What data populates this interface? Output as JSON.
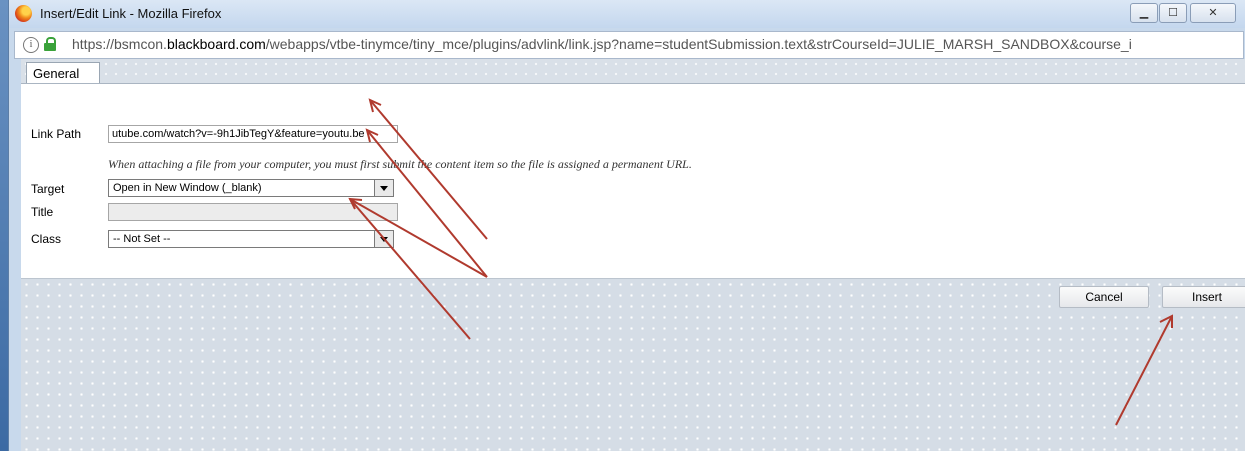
{
  "window": {
    "title": "Insert/Edit Link - Mozilla Firefox",
    "url_prefix": "https://bsmcon.",
    "url_domain": "blackboard.com",
    "url_suffix": "/webapps/vtbe-tinymce/tiny_mce/plugins/advlink/link.jsp?name=studentSubmission.text&strCourseId=JULIE_MARSH_SANDBOX&course_i",
    "icons": {
      "browser": "firefox-icon",
      "info": "info-icon",
      "secure": "lock-icon"
    }
  },
  "dialog": {
    "tab_label": "General",
    "fields": {
      "link_path": {
        "label": "Link Path",
        "value": "utube.com/watch?v=-9h1JibTegY&feature=youtu.be"
      },
      "hint": "When attaching a file from your computer, you must first submit the content item so the file is assigned a permanent URL.",
      "target": {
        "label": "Target",
        "value": "Open in New Window (_blank)"
      },
      "title": {
        "label": "Title",
        "value": ""
      },
      "class": {
        "label": "Class",
        "value": "-- Not Set --"
      }
    },
    "buttons": {
      "cancel": "Cancel",
      "insert": "Insert"
    }
  },
  "annotation": {
    "arrow_color": "#b03a2e",
    "arrow_count": 5
  }
}
